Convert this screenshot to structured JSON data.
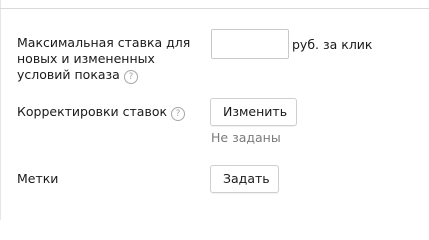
{
  "max_bid": {
    "label_line1": "Максимальная ставка для",
    "label_line2": "новых и измененных",
    "label_line3": "условий показа",
    "value": "",
    "unit": "руб. за клик"
  },
  "bid_adjustments": {
    "label": "Корректировки ставок",
    "button_label": "Изменить",
    "status": "Не заданы"
  },
  "tags": {
    "label": "Метки",
    "button_label": "Задать"
  },
  "icons": {
    "help": "question-circle-icon",
    "help_glyph": "?"
  }
}
